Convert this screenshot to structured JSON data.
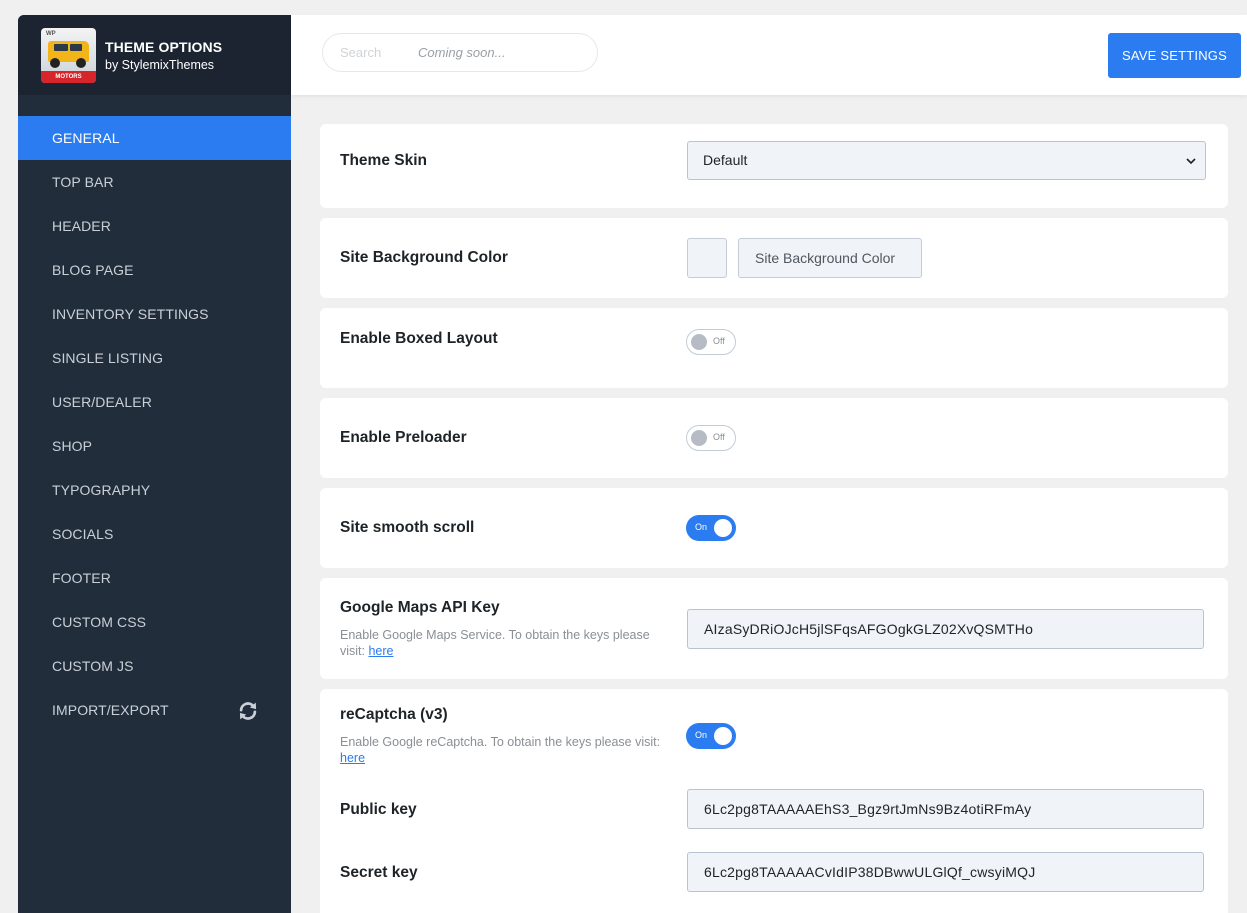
{
  "brand": {
    "title": "THEME OPTIONS",
    "subtitle": "by StylemixThemes",
    "logo_corner": "WP",
    "logo_band": "MOTORS"
  },
  "sidebar": {
    "items": [
      {
        "label": "GENERAL",
        "active": true
      },
      {
        "label": "TOP BAR"
      },
      {
        "label": "HEADER"
      },
      {
        "label": "BLOG PAGE"
      },
      {
        "label": "INVENTORY SETTINGS"
      },
      {
        "label": "SINGLE LISTING"
      },
      {
        "label": "USER/DEALER"
      },
      {
        "label": "SHOP"
      },
      {
        "label": "TYPOGRAPHY"
      },
      {
        "label": "SOCIALS"
      },
      {
        "label": "FOOTER"
      },
      {
        "label": "CUSTOM CSS"
      },
      {
        "label": "CUSTOM JS"
      },
      {
        "label": "IMPORT/EXPORT",
        "icon": "sync-icon"
      }
    ]
  },
  "header": {
    "search_placeholder": "Search",
    "search_note": "Coming soon...",
    "save_label": "SAVE SETTINGS"
  },
  "settings": {
    "theme_skin": {
      "label": "Theme Skin",
      "value": "Default"
    },
    "site_bg": {
      "label": "Site Background Color",
      "placeholder": "Site Background Color"
    },
    "boxed_layout": {
      "label": "Enable Boxed Layout",
      "state": "Off"
    },
    "preloader": {
      "label": "Enable Preloader",
      "state": "Off"
    },
    "smooth_scroll": {
      "label": "Site smooth scroll",
      "state": "On"
    },
    "gmaps": {
      "label": "Google Maps API Key",
      "desc": "Enable Google Maps Service. To obtain the keys please visit:",
      "link": "here",
      "value": "AIzaSyDRiOJcH5jlSFqsAFGOgkGLZ02XvQSMTHo"
    },
    "recaptcha": {
      "label": "reCaptcha (v3)",
      "desc": "Enable Google reCaptcha. To obtain the keys please visit:",
      "link": "here",
      "state": "On",
      "public_label": "Public key",
      "public_value": "6Lc2pg8TAAAAAEhS3_Bgz9rtJmNs9Bz4otiRFmAy",
      "secret_label": "Secret key",
      "secret_value": "6Lc2pg8TAAAAACvIdIP38DBwwULGlQf_cwsyiMQJ"
    }
  },
  "colors": {
    "accent": "#2a7cf0",
    "sidebar_bg": "#222d3c",
    "brand_bg": "#1b2430"
  }
}
